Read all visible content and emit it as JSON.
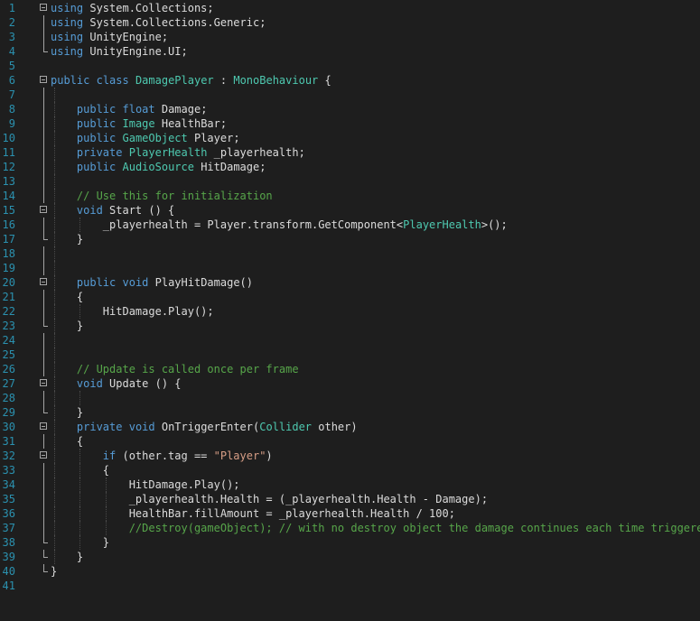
{
  "editor": {
    "language": "C#",
    "colors": {
      "background": "#1e1e1e",
      "line_number": "#2b91af",
      "keyword": "#569cd6",
      "type": "#4ec9b0",
      "string": "#d69d85",
      "comment": "#57a64a",
      "text": "#dcdcdc"
    },
    "lines": [
      {
        "n": "1",
        "fold": "start",
        "guides": [],
        "tokens": [
          {
            "t": "kw",
            "v": "using"
          },
          {
            "t": "",
            "v": " System.Collections;"
          }
        ]
      },
      {
        "n": "2",
        "fold": "line",
        "guides": [],
        "tokens": [
          {
            "t": "kw",
            "v": "using"
          },
          {
            "t": "",
            "v": " System.Collections.Generic;"
          }
        ]
      },
      {
        "n": "3",
        "fold": "line",
        "guides": [],
        "tokens": [
          {
            "t": "kw",
            "v": "using"
          },
          {
            "t": "",
            "v": " UnityEngine;"
          }
        ]
      },
      {
        "n": "4",
        "fold": "end",
        "guides": [],
        "tokens": [
          {
            "t": "kw",
            "v": "using"
          },
          {
            "t": "",
            "v": " UnityEngine.UI;"
          }
        ]
      },
      {
        "n": "5",
        "fold": "",
        "guides": [],
        "tokens": []
      },
      {
        "n": "6",
        "fold": "start",
        "guides": [],
        "tokens": [
          {
            "t": "kw",
            "v": "public"
          },
          {
            "t": "",
            "v": " "
          },
          {
            "t": "kw",
            "v": "class"
          },
          {
            "t": "",
            "v": " "
          },
          {
            "t": "ty",
            "v": "DamagePlayer"
          },
          {
            "t": "",
            "v": " : "
          },
          {
            "t": "ty",
            "v": "MonoBehaviour"
          },
          {
            "t": "",
            "v": " {"
          }
        ]
      },
      {
        "n": "7",
        "fold": "line",
        "guides": [
          1
        ],
        "tokens": []
      },
      {
        "n": "8",
        "fold": "line",
        "guides": [
          1
        ],
        "tokens": [
          {
            "t": "",
            "v": "    "
          },
          {
            "t": "kw",
            "v": "public"
          },
          {
            "t": "",
            "v": " "
          },
          {
            "t": "kw",
            "v": "float"
          },
          {
            "t": "",
            "v": " Damage;"
          }
        ]
      },
      {
        "n": "9",
        "fold": "line",
        "guides": [
          1
        ],
        "tokens": [
          {
            "t": "",
            "v": "    "
          },
          {
            "t": "kw",
            "v": "public"
          },
          {
            "t": "",
            "v": " "
          },
          {
            "t": "ty",
            "v": "Image"
          },
          {
            "t": "",
            "v": " HealthBar;"
          }
        ]
      },
      {
        "n": "10",
        "fold": "line",
        "guides": [
          1
        ],
        "tokens": [
          {
            "t": "",
            "v": "    "
          },
          {
            "t": "kw",
            "v": "public"
          },
          {
            "t": "",
            "v": " "
          },
          {
            "t": "ty",
            "v": "GameObject"
          },
          {
            "t": "",
            "v": " Player;"
          }
        ]
      },
      {
        "n": "11",
        "fold": "line",
        "guides": [
          1
        ],
        "tokens": [
          {
            "t": "",
            "v": "    "
          },
          {
            "t": "kw",
            "v": "private"
          },
          {
            "t": "",
            "v": " "
          },
          {
            "t": "ty",
            "v": "PlayerHealth"
          },
          {
            "t": "",
            "v": " _playerhealth;"
          }
        ]
      },
      {
        "n": "12",
        "fold": "line",
        "guides": [
          1
        ],
        "tokens": [
          {
            "t": "",
            "v": "    "
          },
          {
            "t": "kw",
            "v": "public"
          },
          {
            "t": "",
            "v": " "
          },
          {
            "t": "ty",
            "v": "AudioSource"
          },
          {
            "t": "",
            "v": " HitDamage;"
          }
        ]
      },
      {
        "n": "13",
        "fold": "line",
        "guides": [
          1
        ],
        "tokens": []
      },
      {
        "n": "14",
        "fold": "line",
        "guides": [
          1
        ],
        "tokens": [
          {
            "t": "",
            "v": "    "
          },
          {
            "t": "cm",
            "v": "// Use this for initialization"
          }
        ]
      },
      {
        "n": "15",
        "fold": "start",
        "guides": [
          1
        ],
        "tokens": [
          {
            "t": "",
            "v": "    "
          },
          {
            "t": "kw",
            "v": "void"
          },
          {
            "t": "",
            "v": " Start () {"
          }
        ]
      },
      {
        "n": "16",
        "fold": "line",
        "guides": [
          1,
          2
        ],
        "tokens": [
          {
            "t": "",
            "v": "        _playerhealth = Player.transform.GetComponent<"
          },
          {
            "t": "ty",
            "v": "PlayerHealth"
          },
          {
            "t": "",
            "v": ">();"
          }
        ]
      },
      {
        "n": "17",
        "fold": "end",
        "guides": [
          1
        ],
        "tokens": [
          {
            "t": "",
            "v": "    }"
          }
        ]
      },
      {
        "n": "18",
        "fold": "line",
        "guides": [
          1
        ],
        "tokens": []
      },
      {
        "n": "19",
        "fold": "line",
        "guides": [
          1
        ],
        "tokens": []
      },
      {
        "n": "20",
        "fold": "start",
        "guides": [
          1
        ],
        "tokens": [
          {
            "t": "",
            "v": "    "
          },
          {
            "t": "kw",
            "v": "public"
          },
          {
            "t": "",
            "v": " "
          },
          {
            "t": "kw",
            "v": "void"
          },
          {
            "t": "",
            "v": " PlayHitDamage()"
          }
        ]
      },
      {
        "n": "21",
        "fold": "line",
        "guides": [
          1
        ],
        "tokens": [
          {
            "t": "",
            "v": "    {"
          }
        ]
      },
      {
        "n": "22",
        "fold": "line",
        "guides": [
          1,
          2
        ],
        "tokens": [
          {
            "t": "",
            "v": "        HitDamage.Play();"
          }
        ]
      },
      {
        "n": "23",
        "fold": "end",
        "guides": [
          1
        ],
        "tokens": [
          {
            "t": "",
            "v": "    }"
          }
        ]
      },
      {
        "n": "24",
        "fold": "line",
        "guides": [
          1
        ],
        "tokens": []
      },
      {
        "n": "25",
        "fold": "line",
        "guides": [
          1
        ],
        "tokens": []
      },
      {
        "n": "26",
        "fold": "line",
        "guides": [
          1
        ],
        "tokens": [
          {
            "t": "",
            "v": "    "
          },
          {
            "t": "cm",
            "v": "// Update is called once per frame"
          }
        ]
      },
      {
        "n": "27",
        "fold": "start",
        "guides": [
          1
        ],
        "tokens": [
          {
            "t": "",
            "v": "    "
          },
          {
            "t": "kw",
            "v": "void"
          },
          {
            "t": "",
            "v": " Update () {"
          }
        ]
      },
      {
        "n": "28",
        "fold": "line",
        "guides": [
          1,
          2
        ],
        "tokens": []
      },
      {
        "n": "29",
        "fold": "end",
        "guides": [
          1
        ],
        "tokens": [
          {
            "t": "",
            "v": "    }"
          }
        ]
      },
      {
        "n": "30",
        "fold": "start",
        "guides": [
          1
        ],
        "tokens": [
          {
            "t": "",
            "v": "    "
          },
          {
            "t": "kw",
            "v": "private"
          },
          {
            "t": "",
            "v": " "
          },
          {
            "t": "kw",
            "v": "void"
          },
          {
            "t": "",
            "v": " OnTriggerEnter("
          },
          {
            "t": "ty",
            "v": "Collider"
          },
          {
            "t": "",
            "v": " other)"
          }
        ]
      },
      {
        "n": "31",
        "fold": "line",
        "guides": [
          1
        ],
        "tokens": [
          {
            "t": "",
            "v": "    {"
          }
        ]
      },
      {
        "n": "32",
        "fold": "start",
        "guides": [
          1,
          2
        ],
        "tokens": [
          {
            "t": "",
            "v": "        "
          },
          {
            "t": "kw",
            "v": "if"
          },
          {
            "t": "",
            "v": " (other.tag == "
          },
          {
            "t": "str",
            "v": "\"Player\""
          },
          {
            "t": "",
            "v": ")"
          }
        ]
      },
      {
        "n": "33",
        "fold": "line",
        "guides": [
          1,
          2
        ],
        "tokens": [
          {
            "t": "",
            "v": "        {"
          }
        ]
      },
      {
        "n": "34",
        "fold": "line",
        "guides": [
          1,
          2,
          3
        ],
        "tokens": [
          {
            "t": "",
            "v": "            HitDamage.Play();"
          }
        ]
      },
      {
        "n": "35",
        "fold": "line",
        "guides": [
          1,
          2,
          3
        ],
        "tokens": [
          {
            "t": "",
            "v": "            _playerhealth.Health = (_playerhealth.Health - Damage);"
          }
        ]
      },
      {
        "n": "36",
        "fold": "line",
        "guides": [
          1,
          2,
          3
        ],
        "tokens": [
          {
            "t": "",
            "v": "            HealthBar.fillAmount = _playerhealth.Health / 100;"
          }
        ]
      },
      {
        "n": "37",
        "fold": "line",
        "guides": [
          1,
          2,
          3
        ],
        "tokens": [
          {
            "t": "",
            "v": "            "
          },
          {
            "t": "cm",
            "v": "//Destroy(gameObject); // with no destroy object the damage continues each time triggered"
          }
        ]
      },
      {
        "n": "38",
        "fold": "end",
        "guides": [
          1,
          2
        ],
        "tokens": [
          {
            "t": "",
            "v": "        }"
          }
        ]
      },
      {
        "n": "39",
        "fold": "end",
        "guides": [
          1
        ],
        "tokens": [
          {
            "t": "",
            "v": "    }"
          }
        ]
      },
      {
        "n": "40",
        "fold": "end",
        "guides": [],
        "tokens": [
          {
            "t": "",
            "v": "}"
          }
        ]
      },
      {
        "n": "41",
        "fold": "",
        "guides": [],
        "tokens": []
      }
    ]
  }
}
